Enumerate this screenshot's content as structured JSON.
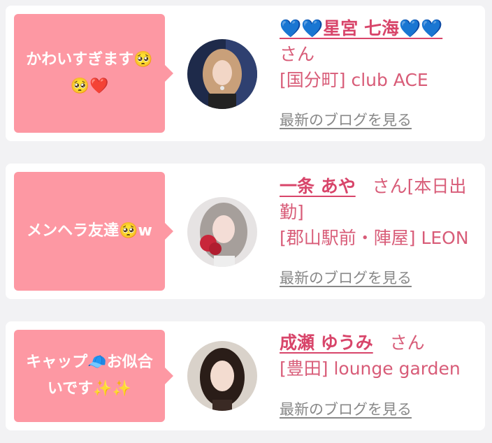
{
  "entries": [
    {
      "comment": "かわいすぎます🥺\n🥺❤️",
      "name": "💙💙星宮 七海💙💙",
      "suffix": "さん",
      "shop": "[国分町] club ACE",
      "blog_link": "最新のブログを見る"
    },
    {
      "comment": "メンヘラ友達🥺w",
      "name": "一条 あや",
      "suffix": "さん[本日出勤]",
      "shop": "[郡山駅前・陣屋] LEON",
      "blog_link": "最新のブログを見る"
    },
    {
      "comment": "キャップ🧢お似合\nいです✨✨",
      "name": "成瀬 ゆうみ",
      "suffix": "さん",
      "shop": "[豊田] lounge garden",
      "blog_link": "最新のブログを見る"
    }
  ],
  "colors": {
    "bubble": "#fd98a3",
    "name": "#d8456a",
    "text": "#d85c78",
    "link": "#888888",
    "background": "#f2f2f4"
  }
}
